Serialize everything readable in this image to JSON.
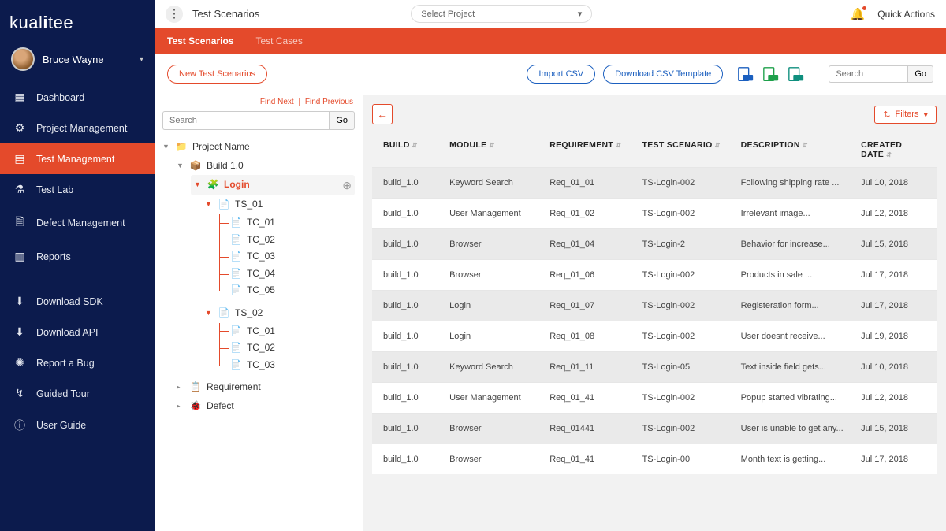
{
  "app": {
    "logo": "kualitee"
  },
  "user": {
    "name": "Bruce Wayne"
  },
  "sidebar": {
    "items": [
      {
        "label": "Dashboard",
        "icon": "▦"
      },
      {
        "label": "Project Management",
        "icon": "⚙"
      },
      {
        "label": "Test Management",
        "icon": "▤",
        "active": true
      },
      {
        "label": "Test Lab",
        "icon": "⚗"
      },
      {
        "label": "Defect Management",
        "icon": "🗎"
      },
      {
        "label": "Reports",
        "icon": "📊"
      }
    ],
    "items2": [
      {
        "label": "Download SDK",
        "icon": "⬇"
      },
      {
        "label": "Download API",
        "icon": "⬇"
      },
      {
        "label": "Report a Bug",
        "icon": "🐞"
      },
      {
        "label": "Guided Tour",
        "icon": "↗"
      },
      {
        "label": "User Guide",
        "icon": "ⓘ"
      }
    ]
  },
  "topbar": {
    "title": "Test Scenarios",
    "select_project": "Select Project",
    "quick_actions": "Quick Actions"
  },
  "tabs": [
    {
      "label": "Test Scenarios",
      "active": true
    },
    {
      "label": "Test Cases"
    }
  ],
  "toolbar": {
    "new_btn": "New Test Scenarios",
    "import_csv": "Import CSV",
    "download_csv_tpl": "Download CSV Template",
    "search_placeholder": "Search",
    "go": "Go"
  },
  "tree": {
    "find_next": "Find Next",
    "find_prev": "Find Previous",
    "search_placeholder": "Search",
    "go": "Go",
    "root": "Project Name",
    "build": "Build 1.0",
    "login": "Login",
    "ts01": "TS_01",
    "ts02": "TS_02",
    "tc": [
      "TC_01",
      "TC_02",
      "TC_03",
      "TC_04",
      "TC_05"
    ],
    "tc2": [
      "TC_01",
      "TC_02",
      "TC_03"
    ],
    "requirement": "Requirement",
    "defect": "Defect"
  },
  "filters_label": "Filters",
  "columns": {
    "build": "BUILD",
    "module": "MODULE",
    "requirement": "REQUIREMENT",
    "scenario": "TEST SCENARIO",
    "description": "DESCRIPTION",
    "created": "CREATED DATE"
  },
  "rows": [
    {
      "build": "build_1.0",
      "module": "Keyword Search",
      "req": "Req_01_01",
      "ts": "TS-Login-002",
      "desc": "Following shipping rate ...",
      "date": "Jul 10, 2018"
    },
    {
      "build": "build_1.0",
      "module": "User Management",
      "req": "Req_01_02",
      "ts": "TS-Login-002",
      "desc": "Irrelevant image...",
      "date": "Jul 12, 2018"
    },
    {
      "build": "build_1.0",
      "module": "Browser",
      "req": "Req_01_04",
      "ts": "TS-Login-2",
      "desc": "Behavior for increase...",
      "date": "Jul 15, 2018"
    },
    {
      "build": "build_1.0",
      "module": "Browser",
      "req": "Req_01_06",
      "ts": "TS-Login-002",
      "desc": "Products in sale ...",
      "date": "Jul 17, 2018"
    },
    {
      "build": "build_1.0",
      "module": "Login",
      "req": "Req_01_07",
      "ts": "TS-Login-002",
      "desc": "Registeration form...",
      "date": "Jul 17, 2018"
    },
    {
      "build": "build_1.0",
      "module": "Login",
      "req": "Req_01_08",
      "ts": "TS-Login-002",
      "desc": "User doesnt receive...",
      "date": "Jul 19, 2018"
    },
    {
      "build": "build_1.0",
      "module": "Keyword Search",
      "req": "Req_01_11",
      "ts": "TS-Login-05",
      "desc": "Text inside field gets...",
      "date": "Jul 10, 2018"
    },
    {
      "build": "build_1.0",
      "module": "User Management",
      "req": "Req_01_41",
      "ts": "TS-Login-002",
      "desc": "Popup started vibrating...",
      "date": "Jul 12, 2018"
    },
    {
      "build": "build_1.0",
      "module": "Browser",
      "req": "Req_01441",
      "ts": "TS-Login-002",
      "desc": "User is unable to get any...",
      "date": "Jul 15, 2018"
    },
    {
      "build": "build_1.0",
      "module": "Browser",
      "req": "Req_01_41",
      "ts": "TS-Login-00",
      "desc": "Month text is getting...",
      "date": "Jul 17, 2018"
    }
  ]
}
